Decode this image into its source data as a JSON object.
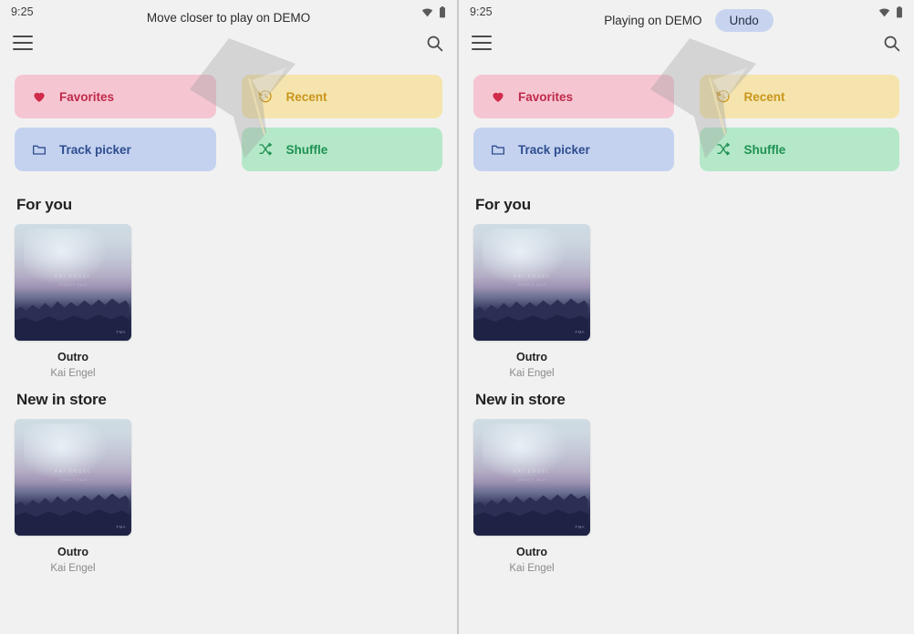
{
  "colors": {
    "background": "#f1f1f1",
    "favorites_bg": "#f5c6d2",
    "favorites_fg": "#c0294a",
    "recent_bg": "#f5e4ad",
    "recent_fg": "#c9961c",
    "trackpicker_bg": "#c4d2f0",
    "trackpicker_fg": "#2e4d8e",
    "shuffle_bg": "#b5e8c8",
    "shuffle_fg": "#1f9153",
    "undo_bg": "#c8d4ef",
    "divider": "#c8c8c8"
  },
  "panels": [
    {
      "id": "left",
      "status": {
        "time": "9:25",
        "wifi_icon": "wifi-icon",
        "battery_icon": "battery-icon"
      },
      "snackbar": {
        "message": "Move closer to play on DEMO",
        "action_label": "",
        "has_action": false
      },
      "appbar": {
        "menu_icon": "hamburger-menu-icon",
        "search_icon": "search-icon"
      },
      "chips": [
        {
          "label": "Favorites",
          "icon": "heart-icon",
          "style": "favorites"
        },
        {
          "label": "Recent",
          "icon": "history-icon",
          "style": "recent"
        },
        {
          "label": "Track picker",
          "icon": "folder-icon",
          "style": "trackpicker"
        },
        {
          "label": "Shuffle",
          "icon": "shuffle-icon",
          "style": "shuffle"
        }
      ],
      "sections": [
        {
          "title": "For you",
          "cards": [
            {
              "title": "Outro",
              "artist": "Kai Engel",
              "art_text": "Kai Engel",
              "art_sub": "Irsen's Tale",
              "art_badge": "FMA"
            }
          ]
        },
        {
          "title": "New in store",
          "cards": [
            {
              "title": "Outro",
              "artist": "Kai Engel",
              "art_text": "Kai Engel",
              "art_sub": "Irsen's Tale",
              "art_badge": "FMA"
            }
          ]
        }
      ]
    },
    {
      "id": "right",
      "status": {
        "time": "9:25",
        "wifi_icon": "wifi-icon",
        "battery_icon": "battery-icon"
      },
      "snackbar": {
        "message": "Playing on DEMO",
        "action_label": "Undo",
        "has_action": true
      },
      "appbar": {
        "menu_icon": "hamburger-menu-icon",
        "search_icon": "search-icon"
      },
      "chips": [
        {
          "label": "Favorites",
          "icon": "heart-icon",
          "style": "favorites"
        },
        {
          "label": "Recent",
          "icon": "history-icon",
          "style": "recent"
        },
        {
          "label": "Track picker",
          "icon": "folder-icon",
          "style": "trackpicker"
        },
        {
          "label": "Shuffle",
          "icon": "shuffle-icon",
          "style": "shuffle"
        }
      ],
      "sections": [
        {
          "title": "For you",
          "cards": [
            {
              "title": "Outro",
              "artist": "Kai Engel",
              "art_text": "Kai Engel",
              "art_sub": "Irsen's Tale",
              "art_badge": "FMA"
            }
          ]
        },
        {
          "title": "New in store",
          "cards": [
            {
              "title": "Outro",
              "artist": "Kai Engel",
              "art_text": "Kai Engel",
              "art_sub": "Irsen's Tale",
              "art_badge": "FMA"
            }
          ]
        }
      ]
    }
  ]
}
